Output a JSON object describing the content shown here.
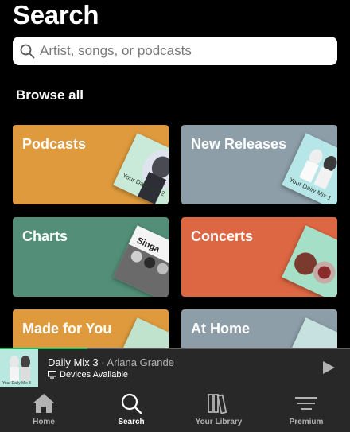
{
  "header": {
    "title": "Search"
  },
  "search": {
    "placeholder": "Artist, songs, or podcasts"
  },
  "browse": {
    "heading": "Browse all"
  },
  "categories": [
    {
      "label": "Podcasts",
      "color": "#df9a3d",
      "art_text": "Your Daily Mix 2"
    },
    {
      "label": "New Releases",
      "color": "#8d9ea8",
      "art_text": "Your Daily Mix 1"
    },
    {
      "label": "Charts",
      "color": "#538f78",
      "art_text": "Singa"
    },
    {
      "label": "Concerts",
      "color": "#dc6742",
      "art_text": ""
    },
    {
      "label": "Made for You",
      "color": "#df9a3d",
      "art_text": ""
    },
    {
      "label": "At Home",
      "color": "#8d9ea8",
      "art_text": ""
    }
  ],
  "now_playing": {
    "title": "Daily Mix 3",
    "separator": " · ",
    "artist": "Ariana Grande",
    "device": "Devices Available",
    "cover_text": "Your Daily Mix 3",
    "progress": 0.25
  },
  "tabs": [
    {
      "label": "Home",
      "icon": "home-icon",
      "active": false
    },
    {
      "label": "Search",
      "icon": "search-icon",
      "active": true
    },
    {
      "label": "Your Library",
      "icon": "library-icon",
      "active": false
    },
    {
      "label": "Premium",
      "icon": "premium-icon",
      "active": false
    }
  ],
  "colors": {
    "accent": "#1db954",
    "bar_bg": "#282828",
    "muted": "#b3b3b3"
  }
}
